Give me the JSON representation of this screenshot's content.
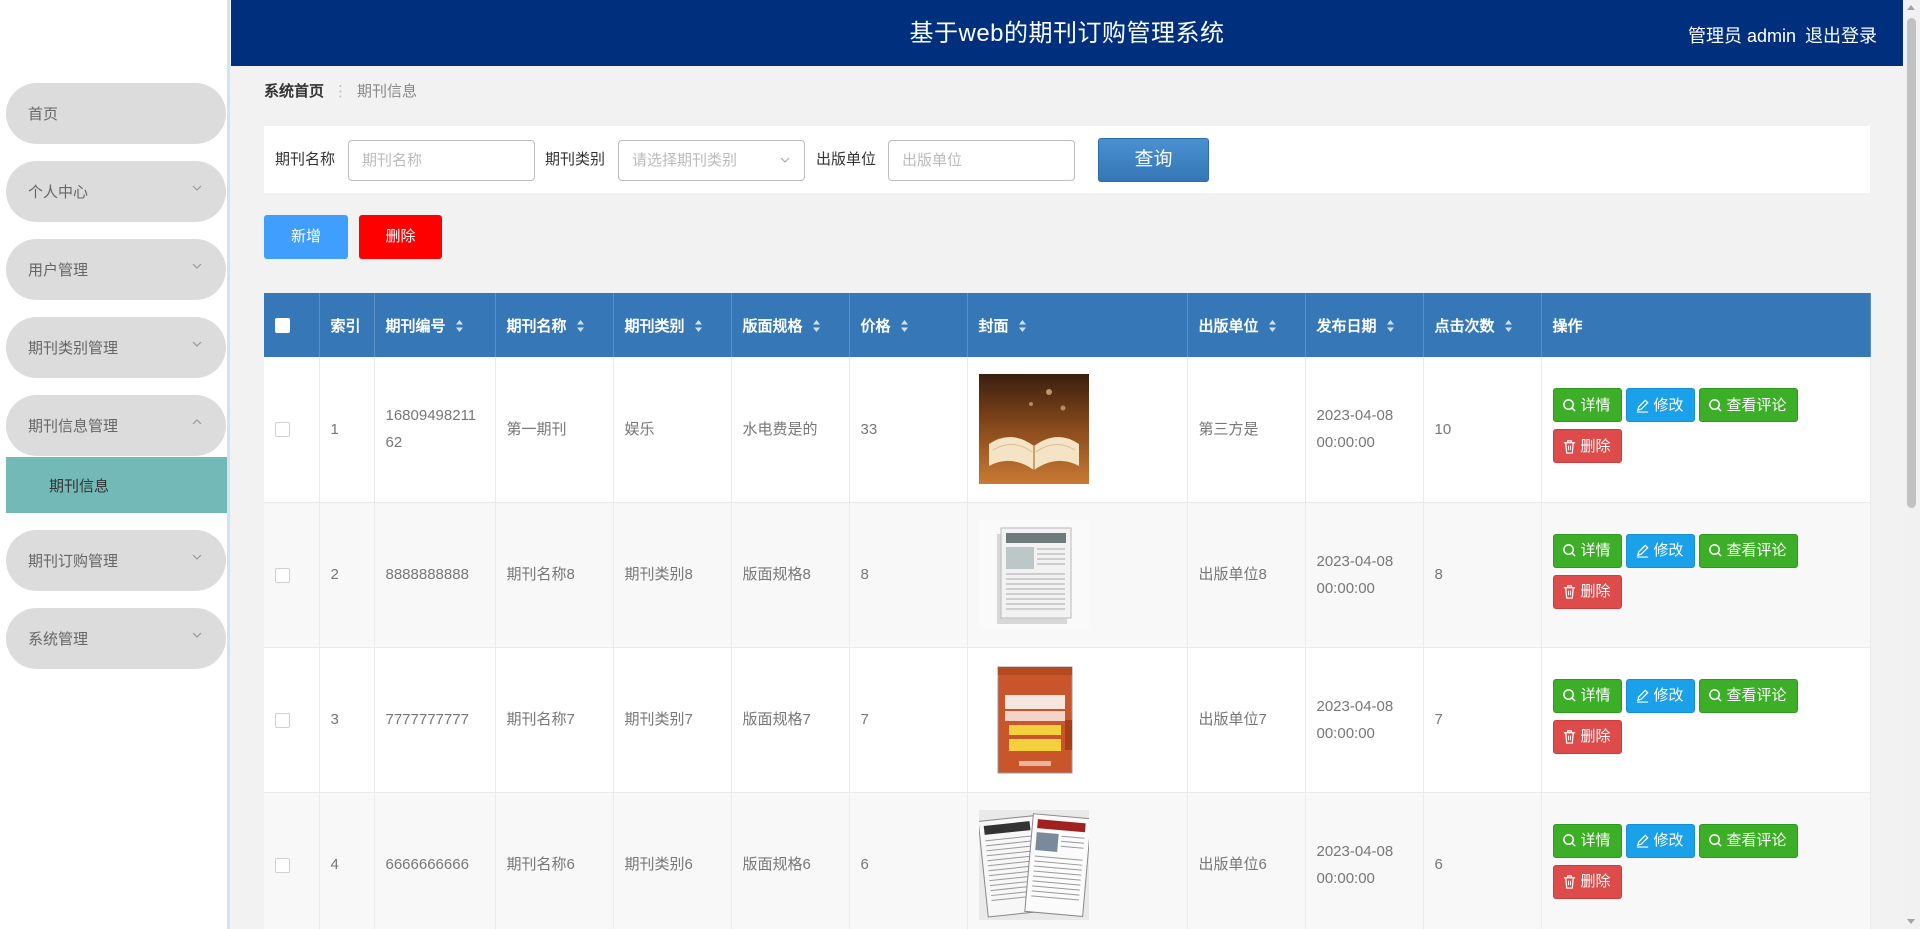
{
  "header": {
    "title": "基于web的期刊订购管理系统",
    "user": "管理员 admin",
    "logout": "退出登录"
  },
  "sidebar": {
    "items": [
      {
        "label": "首页",
        "expandable": false
      },
      {
        "label": "个人中心",
        "expandable": true
      },
      {
        "label": "用户管理",
        "expandable": true
      },
      {
        "label": "期刊类别管理",
        "expandable": true
      },
      {
        "label": "期刊信息管理",
        "expandable": true,
        "expanded": true
      },
      {
        "label": "期刊订购管理",
        "expandable": true
      },
      {
        "label": "系统管理",
        "expandable": true
      }
    ],
    "active_sub": "期刊信息"
  },
  "breadcrumb": {
    "home": "系统首页",
    "separator": "⋮",
    "current": "期刊信息"
  },
  "search": {
    "name_label": "期刊名称",
    "name_placeholder": "期刊名称",
    "category_label": "期刊类别",
    "category_placeholder": "请选择期刊类别",
    "publisher_label": "出版单位",
    "publisher_placeholder": "出版单位",
    "query_button": "查询"
  },
  "actions": {
    "add": "新增",
    "delete": "删除"
  },
  "table": {
    "columns": [
      "索引",
      "期刊编号",
      "期刊名称",
      "期刊类别",
      "版面规格",
      "价格",
      "封面",
      "出版单位",
      "发布日期",
      "点击次数",
      "操作"
    ],
    "ops": {
      "detail": "详情",
      "edit": "修改",
      "comments": "查看评论",
      "delete": "删除"
    },
    "rows": [
      {
        "index": "1",
        "code": "1680949821162",
        "name": "第一期刊",
        "category": "娱乐",
        "spec": "水电费是的",
        "price": "33",
        "publisher": "第三方是",
        "date": "2023-04-08 00:00:00",
        "clicks": "10"
      },
      {
        "index": "2",
        "code": "8888888888",
        "name": "期刊名称8",
        "category": "期刊类别8",
        "spec": "版面规格8",
        "price": "8",
        "publisher": "出版单位8",
        "date": "2023-04-08 00:00:00",
        "clicks": "8"
      },
      {
        "index": "3",
        "code": "7777777777",
        "name": "期刊名称7",
        "category": "期刊类别7",
        "spec": "版面规格7",
        "price": "7",
        "publisher": "出版单位7",
        "date": "2023-04-08 00:00:00",
        "clicks": "7"
      },
      {
        "index": "4",
        "code": "6666666666",
        "name": "期刊名称6",
        "category": "期刊类别6",
        "spec": "版面规格6",
        "price": "6",
        "publisher": "出版单位6",
        "date": "2023-04-08 00:00:00",
        "clicks": "6"
      }
    ]
  },
  "colors": {
    "header_bg": "#002f7d",
    "table_header_bg": "#3677b8",
    "sidebar_active_bg": "#72b9b7",
    "btn_add": "#409eff",
    "btn_delete": "#ff0000",
    "op_green": "#3dae27",
    "op_blue": "#1aa1e9",
    "op_red": "#de4b4b"
  }
}
